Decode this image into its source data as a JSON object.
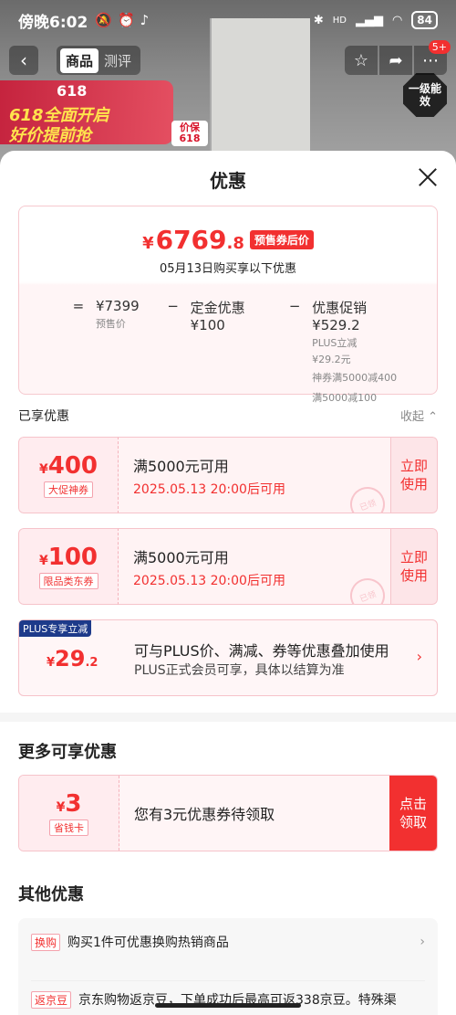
{
  "status_bar": {
    "time": "傍晚6:02",
    "battery": "84",
    "network": "HD"
  },
  "background": {
    "banner_618": "618",
    "banner_line1": "618全面开启",
    "banner_line2": "好价提前抢",
    "price_guarantee": "价保618",
    "energy_label": "一级能效"
  },
  "nav": {
    "back": "‹",
    "tabs": [
      "商品",
      "测评"
    ],
    "active_tab": 0,
    "badge": "5+"
  },
  "sheet": {
    "title": "优惠",
    "summary": {
      "currency": "¥",
      "price_int": "6769",
      "price_dec": ".8",
      "price_tag": "预售券后价",
      "subtitle": "05月13日购买享以下优惠",
      "eq": "=",
      "minus": "−",
      "presale_price": "¥7399",
      "presale_label": "预售价",
      "deposit_discount": "定金优惠 ¥100",
      "promo_discount": "优惠促销 ¥529.2",
      "promo_detail_1": "PLUS立减",
      "promo_detail_2": "¥29.2元",
      "promo_detail_3": "神券满5000减400",
      "promo_detail_4": "满5000减100"
    },
    "enjoyed": {
      "title": "已享优惠",
      "collapse": "收起 ⌃"
    },
    "coupons": [
      {
        "yen": "¥",
        "amount": "400",
        "name": "大促神券",
        "condition": "满5000元可用",
        "time": "2025.05.13 20:00后可用",
        "action": "立即使用",
        "stamp": "已领"
      },
      {
        "yen": "¥",
        "amount": "100",
        "name": "限品类东券",
        "condition": "满5000元可用",
        "time": "2025.05.13 20:00后可用",
        "action": "立即使用",
        "stamp": "已领"
      }
    ],
    "plus": {
      "badge": "PLUS专享立减",
      "yen": "¥",
      "amount": "29",
      "dec": ".2",
      "line1": "可与PLUS价、满减、券等优惠叠加使用",
      "line2": "PLUS正式会员可享，具体以结算为准",
      "arrow": "›"
    },
    "more": {
      "title": "更多可享优惠",
      "yen": "¥",
      "amount": "3",
      "name": "省钱卡",
      "text": "您有3元优惠券待领取",
      "action": "点击领取"
    },
    "other": {
      "title": "其他优惠",
      "rows": [
        {
          "tag": "换购",
          "text": "购买1件可优惠换购热销商品",
          "arrow": "›"
        },
        {
          "tag": "返京豆",
          "text": "京东购物返京豆，下单成功后最高可返338京豆。特殊渠",
          "arrow": ""
        }
      ]
    }
  },
  "colors": {
    "accent": "#f23030",
    "plus_blue": "#1d3a8a"
  }
}
